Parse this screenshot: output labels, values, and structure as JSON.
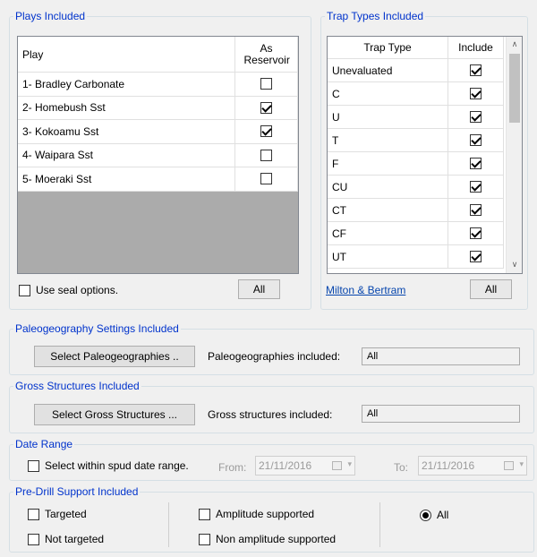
{
  "plays": {
    "title": "Plays Included",
    "col_play": "Play",
    "col_reservoir": "As Reservoir",
    "rows": [
      {
        "name": "1- Bradley Carbonate",
        "checked": false
      },
      {
        "name": "2- Homebush Sst",
        "checked": true
      },
      {
        "name": "3- Kokoamu Sst",
        "checked": true
      },
      {
        "name": "4- Waipara Sst",
        "checked": false
      },
      {
        "name": "5- Moeraki Sst",
        "checked": false
      }
    ],
    "seal_label": "Use seal options.",
    "seal_checked": false,
    "all_label": "All"
  },
  "traps": {
    "title": "Trap Types Included",
    "col_type": "Trap Type",
    "col_include": "Include",
    "rows": [
      {
        "name": "Unevaluated",
        "checked": true
      },
      {
        "name": "C",
        "checked": true
      },
      {
        "name": "U",
        "checked": true
      },
      {
        "name": "T",
        "checked": true
      },
      {
        "name": "F",
        "checked": true
      },
      {
        "name": "CU",
        "checked": true
      },
      {
        "name": "CT",
        "checked": true
      },
      {
        "name": "CF",
        "checked": true
      },
      {
        "name": "UT",
        "checked": true
      }
    ],
    "link_label": "Milton & Bertram",
    "all_label": "All"
  },
  "paleo": {
    "title": "Paleogeography Settings Included",
    "button_label": "Select Paleogeographies ..",
    "included_label": "Paleogeographies included:",
    "included_value": "All"
  },
  "gross": {
    "title": "Gross Structures Included",
    "button_label": "Select Gross Structures ...",
    "included_label": "Gross structures included:",
    "included_value": "All"
  },
  "date_range": {
    "title": "Date Range",
    "checkbox_label": "Select within spud date range.",
    "checked": false,
    "from_label": "From:",
    "from_value": "21/11/2016",
    "to_label": "To:",
    "to_value": "21/11/2016"
  },
  "predrill": {
    "title": "Pre-Drill Support Included",
    "targeted": "Targeted",
    "not_targeted": "Not targeted",
    "amplitude": "Amplitude supported",
    "non_amplitude": "Non amplitude supported",
    "all_label": "All",
    "all_selected": true
  }
}
